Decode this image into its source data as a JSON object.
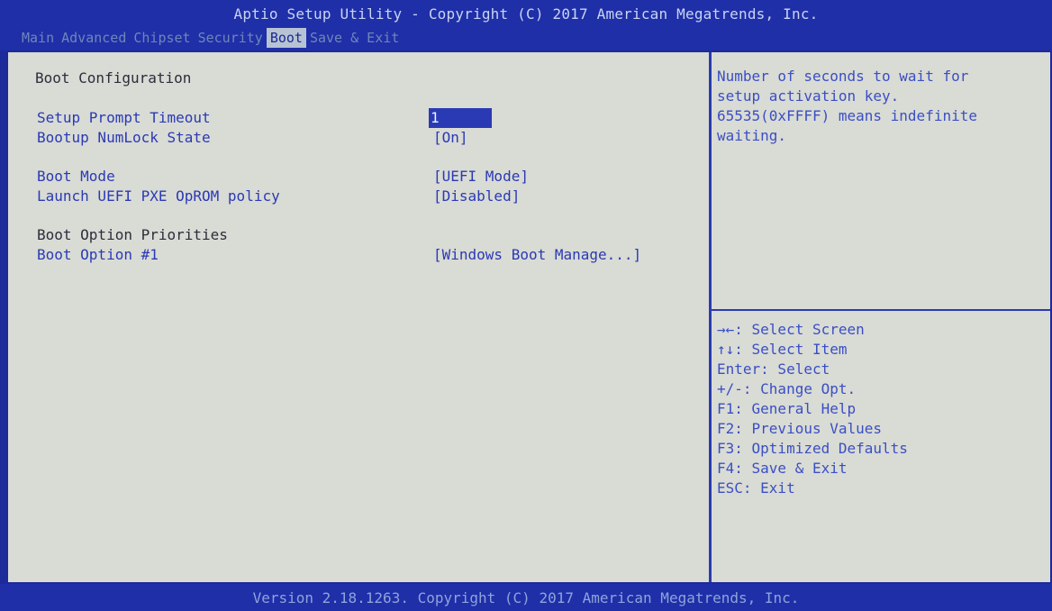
{
  "header": {
    "title": "Aptio Setup Utility - Copyright (C) 2017 American Megatrends, Inc.",
    "tabs": [
      "Main",
      "Advanced",
      "Chipset",
      "Security",
      "Boot",
      "Save & Exit"
    ],
    "active_tab": "Boot"
  },
  "main": {
    "section_title": "Boot Configuration",
    "settings": [
      {
        "label": "Setup Prompt Timeout",
        "value": "1"
      },
      {
        "label": "Bootup NumLock State",
        "value": "[On]"
      },
      {
        "label": "Boot Mode",
        "value": "[UEFI Mode]"
      },
      {
        "label": "Launch UEFI PXE OpROM policy",
        "value": "[Disabled]"
      }
    ],
    "priorities_title": "Boot Option Priorities",
    "boot_option": {
      "label": "Boot Option #1",
      "value": "[Windows Boot Manage...]"
    }
  },
  "help": {
    "lines": [
      "Number of seconds to wait for",
      "setup activation key.",
      "65535(0xFFFF) means indefinite",
      "waiting."
    ]
  },
  "keys": [
    "→←: Select Screen",
    "↑↓: Select Item",
    "Enter: Select",
    "+/-: Change Opt.",
    "F1: General Help",
    "F2: Previous Values",
    "F3: Optimized Defaults",
    "F4: Save & Exit",
    "ESC: Exit"
  ],
  "footer": {
    "version": "Version 2.18.1263. Copyright (C) 2017 American Megatrends, Inc."
  },
  "colors": {
    "frame_blue": "#1f2fa8",
    "panel_bg": "#d9dbd5",
    "label_blue": "#2a3ab4",
    "static_text": "#2a2e3a"
  }
}
